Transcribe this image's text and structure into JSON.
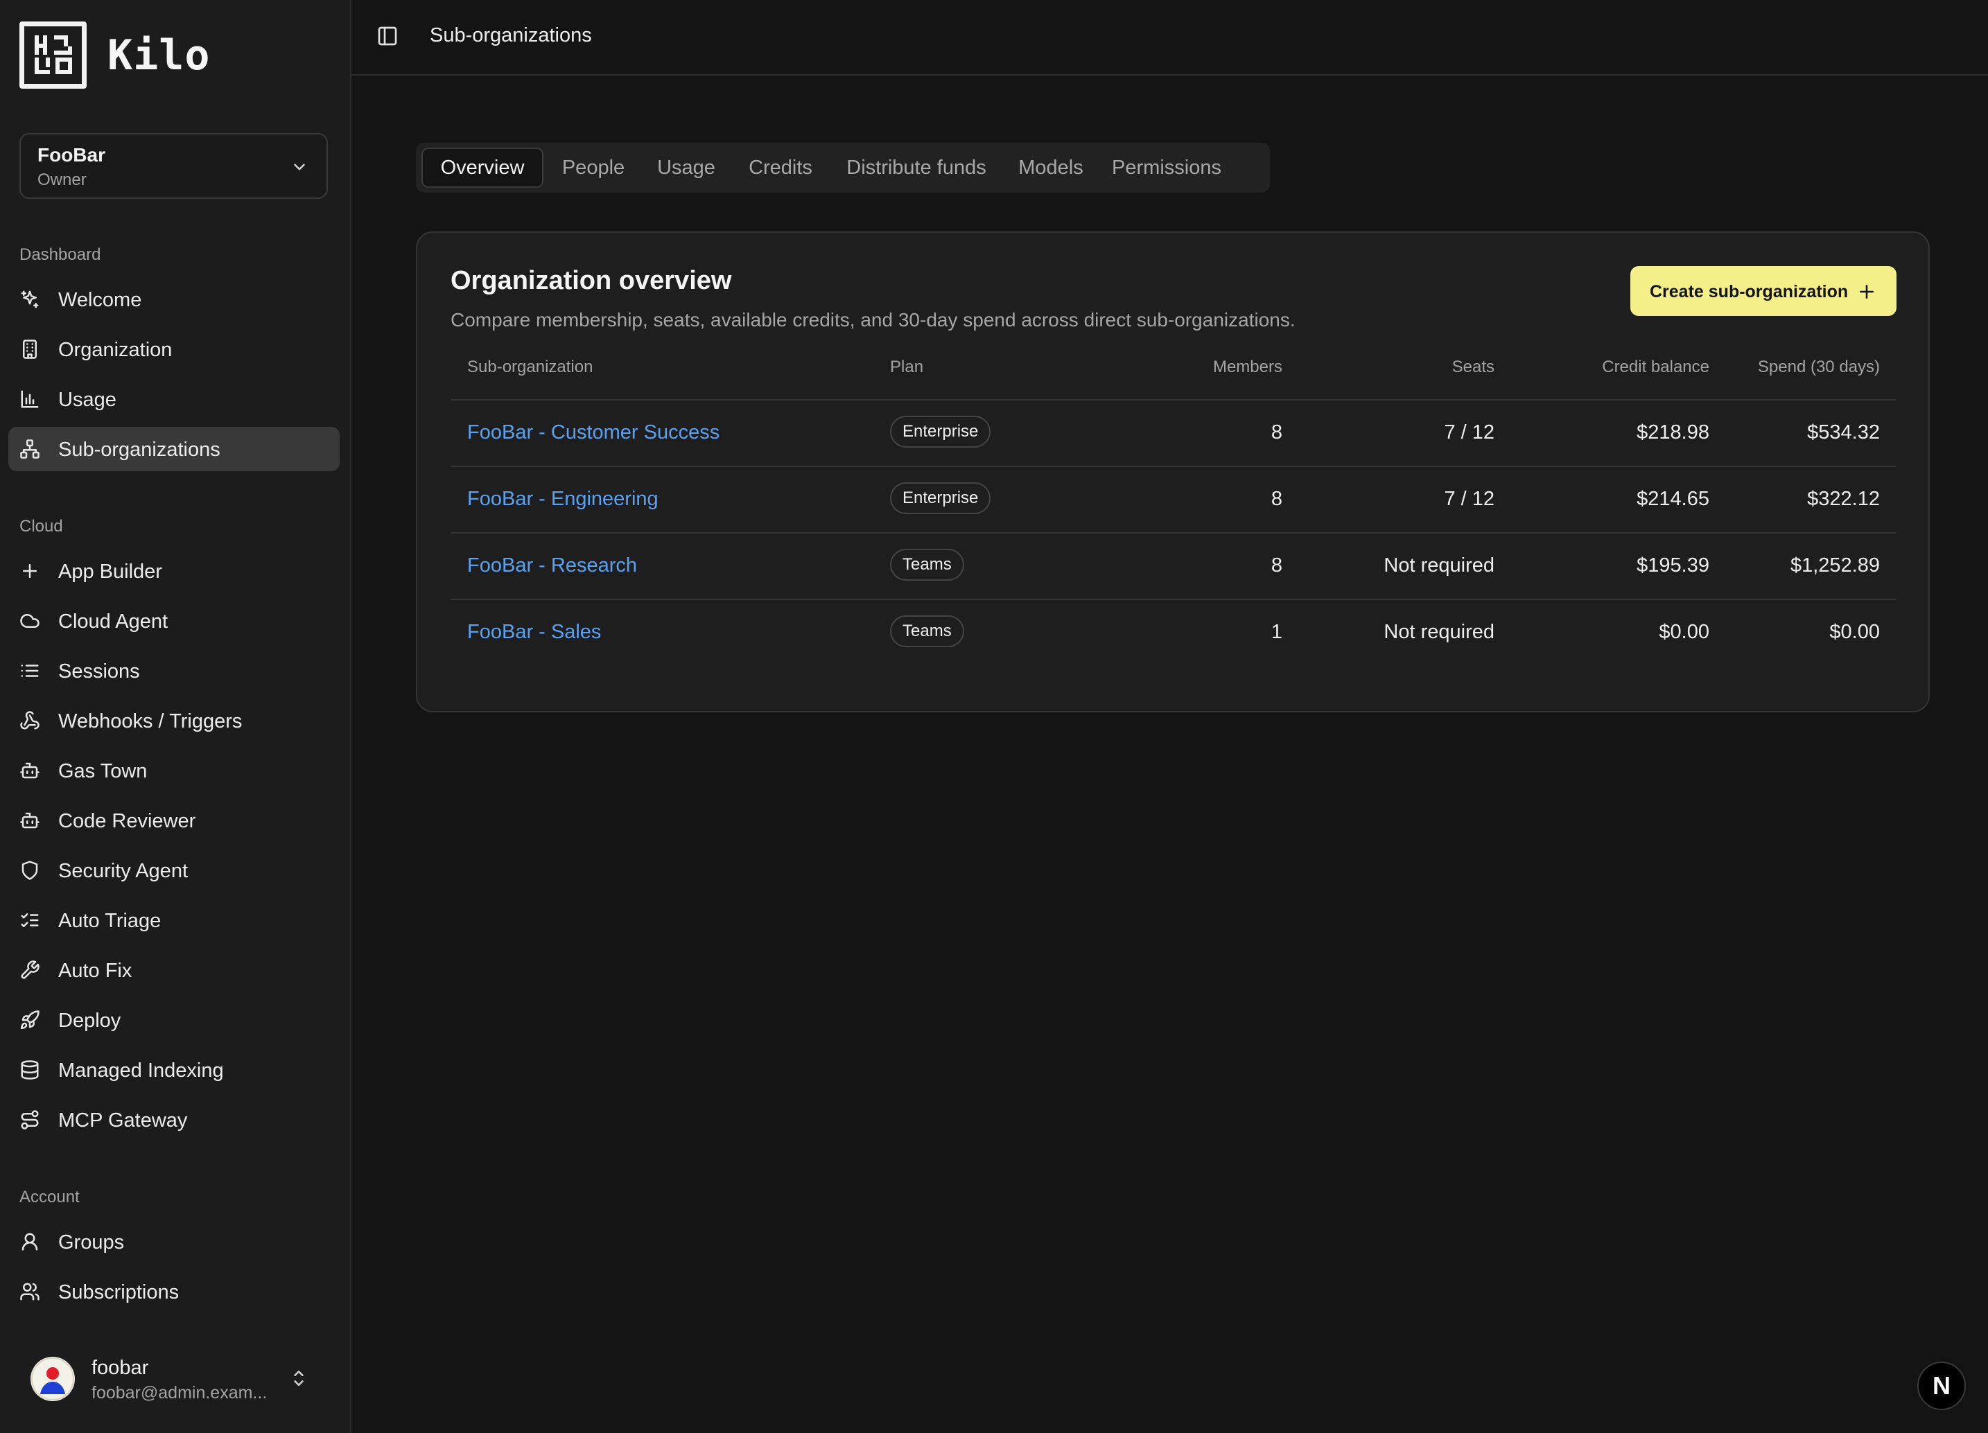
{
  "brand": {
    "name": "Kilo"
  },
  "org_switcher": {
    "name": "FooBar",
    "role": "Owner"
  },
  "nav": {
    "dashboard_heading": "Dashboard",
    "dashboard_items": [
      {
        "label": "Welcome",
        "icon": "sparkles-icon"
      },
      {
        "label": "Organization",
        "icon": "building-icon"
      },
      {
        "label": "Usage",
        "icon": "bar-chart-icon"
      },
      {
        "label": "Sub-organizations",
        "icon": "network-icon",
        "active": true
      }
    ],
    "cloud_heading": "Cloud",
    "cloud_items": [
      {
        "label": "App Builder",
        "icon": "plus-icon"
      },
      {
        "label": "Cloud Agent",
        "icon": "cloud-icon"
      },
      {
        "label": "Sessions",
        "icon": "list-icon"
      },
      {
        "label": "Webhooks / Triggers",
        "icon": "webhook-icon"
      },
      {
        "label": "Gas Town",
        "icon": "bot-icon"
      },
      {
        "label": "Code Reviewer",
        "icon": "bot-icon"
      },
      {
        "label": "Security Agent",
        "icon": "shield-icon"
      },
      {
        "label": "Auto Triage",
        "icon": "list-checks-icon"
      },
      {
        "label": "Auto Fix",
        "icon": "wrench-icon"
      },
      {
        "label": "Deploy",
        "icon": "rocket-icon"
      },
      {
        "label": "Managed Indexing",
        "icon": "database-icon"
      },
      {
        "label": "MCP Gateway",
        "icon": "route-icon"
      }
    ],
    "account_heading": "Account",
    "account_items": [
      {
        "label": "Groups",
        "icon": "user-icon"
      },
      {
        "label": "Subscriptions",
        "icon": "users-icon"
      }
    ]
  },
  "user": {
    "name": "foobar",
    "email": "foobar@admin.exam..."
  },
  "topbar": {
    "breadcrumb": "Sub-organizations"
  },
  "tabs": [
    {
      "label": "Overview",
      "active": true
    },
    {
      "label": "People"
    },
    {
      "label": "Usage"
    },
    {
      "label": "Credits"
    },
    {
      "label": "Distribute funds"
    },
    {
      "label": "Models"
    },
    {
      "label": "Permissions"
    }
  ],
  "overview": {
    "title": "Organization overview",
    "subtitle": "Compare membership, seats, available credits, and 30-day spend across direct sub-organizations.",
    "create_button": "Create sub-organization",
    "columns": [
      "Sub-organization",
      "Plan",
      "Members",
      "Seats",
      "Credit balance",
      "Spend (30 days)"
    ],
    "rows": [
      {
        "name": "FooBar - Customer Success",
        "plan": "Enterprise",
        "members": "8",
        "seats": "7 / 12",
        "credit": "$218.98",
        "spend": "$534.32"
      },
      {
        "name": "FooBar - Engineering",
        "plan": "Enterprise",
        "members": "8",
        "seats": "7 / 12",
        "credit": "$214.65",
        "spend": "$322.12"
      },
      {
        "name": "FooBar - Research",
        "plan": "Teams",
        "members": "8",
        "seats": "Not required",
        "credit": "$195.39",
        "spend": "$1,252.89"
      },
      {
        "name": "FooBar - Sales",
        "plan": "Teams",
        "members": "1",
        "seats": "Not required",
        "credit": "$0.00",
        "spend": "$0.00"
      }
    ]
  },
  "dev_badge": {
    "label": "N"
  }
}
